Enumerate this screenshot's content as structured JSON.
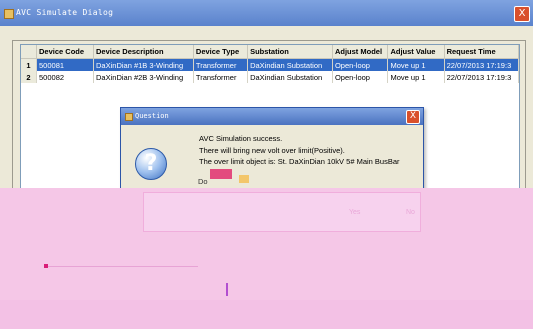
{
  "window": {
    "title": "AVC Simulate Dialog",
    "close_glyph": "X"
  },
  "table": {
    "columns": [
      "",
      "Device Code",
      "Device Description",
      "Device Type",
      "Substation",
      "Adjust Model",
      "Adjust Value",
      "Request Time"
    ],
    "rows": [
      {
        "rn": "1",
        "device_code": "500081",
        "device_description": "DaXinDian #1B 3-Winding",
        "device_type": "Transformer",
        "substation": "DaXindian Substation",
        "adjust_model": "Open-loop",
        "adjust_value": "Move up 1",
        "request_time": "22/07/2013 17:19:3"
      },
      {
        "rn": "2",
        "device_code": "500082",
        "device_description": "DaXinDian #2B 3-Winding",
        "device_type": "Transformer",
        "substation": "DaXindian Substation",
        "adjust_model": "Open-loop",
        "adjust_value": "Move up 1",
        "request_time": "22/07/2013 17:19:3"
      }
    ]
  },
  "dialog": {
    "title": "Question",
    "close_glyph": "X",
    "icon_glyph": "?",
    "lines": [
      "AVC Simulation success.",
      "There will bring new volt over limit(Positive).",
      "The over limit object is: St. DaXinDian 10kV 5# Main BusBar",
      "Do"
    ],
    "yes_label": "Yes",
    "no_label": "No"
  },
  "colors": {
    "overlay_pink": "#f5c7e7",
    "accent_blue": "#316ac5",
    "title_blue": "#5a82cc"
  }
}
